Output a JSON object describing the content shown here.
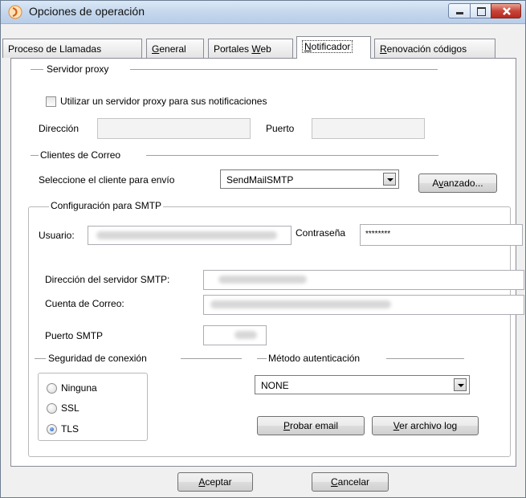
{
  "window": {
    "title": "Opciones de operación"
  },
  "tabs": [
    {
      "label": "Proceso de Llamadas"
    },
    {
      "label": "General",
      "mnemonic": "G",
      "rest": "eneral"
    },
    {
      "label": "Portales Web",
      "pre": "Portales ",
      "mnemonic": "W",
      "rest": "eb"
    },
    {
      "label": "Notificador",
      "mnemonic": "N",
      "rest": "otificador",
      "active": true
    },
    {
      "label": "Renovación códigos",
      "mnemonic": "R",
      "rest": "enovación códigos"
    }
  ],
  "proxy": {
    "section_title": "Servidor proxy",
    "checkbox_label": "Utilizar un servidor proxy para sus notificaciones",
    "checked": false,
    "address_label": "Dirección",
    "address_value": "",
    "port_label": "Puerto",
    "port_value": ""
  },
  "mail_clients": {
    "section_title": "Clientes de Correo",
    "select_label": "Seleccione el cliente para envío",
    "selected_client": "SendMailSMTP",
    "advanced_button": {
      "mnemonic_pre": "A",
      "mnemonic": "v",
      "rest": "anzado..."
    }
  },
  "smtp": {
    "section_title": "Configuración para SMTP",
    "user_label": "Usuario:",
    "password_label": "Contraseña",
    "password_value": "********",
    "server_label": "Dirección del servidor SMTP:",
    "account_label": "Cuenta de Correo:",
    "port_label": "Puerto SMTP"
  },
  "security": {
    "section_title": "Seguridad de conexión",
    "options": [
      "Ninguna",
      "SSL",
      "TLS"
    ],
    "selected": "TLS"
  },
  "auth": {
    "section_title": "Método autenticación",
    "selected": "NONE"
  },
  "buttons": {
    "test_email": {
      "mnemonic": "P",
      "rest": "robar email"
    },
    "view_log": {
      "mnemonic": "V",
      "rest": "er archivo log"
    },
    "accept": {
      "mnemonic": "A",
      "rest": "ceptar"
    },
    "cancel": {
      "mnemonic": "C",
      "rest": "ancelar"
    }
  },
  "colors": {
    "titlebar": "#c3d6ed",
    "close_button": "#c7453a",
    "panel_bg": "#ffffff",
    "window_bg": "#f0f0f0"
  }
}
